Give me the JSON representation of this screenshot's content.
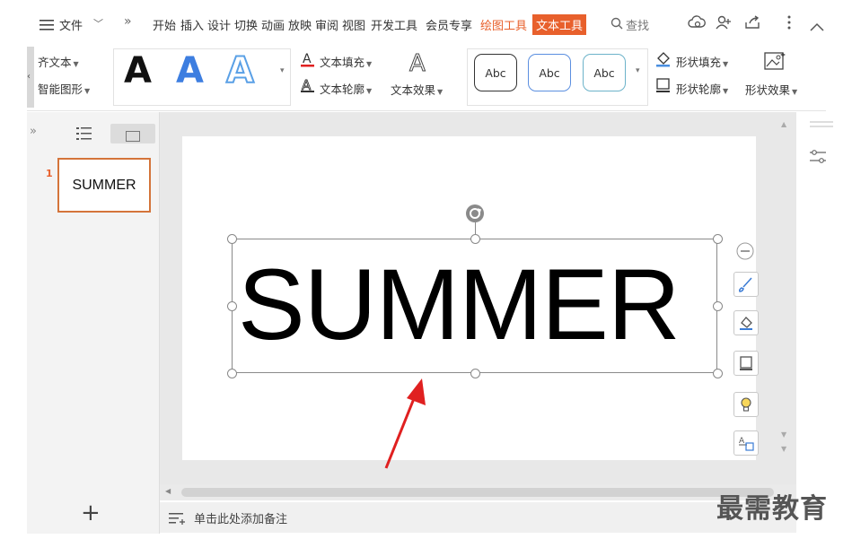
{
  "menubar": {
    "file_label": "文件",
    "tabs": [
      "开始",
      "插入",
      "设计",
      "切换",
      "动画",
      "放映",
      "审阅",
      "视图",
      "开发工具",
      "会员专享"
    ],
    "draw_tools_tab": "绘图工具",
    "text_tools_tab": "文本工具",
    "search_label": "查找"
  },
  "ribbon": {
    "align_text": "齐文本",
    "smart_shape": "智能图形",
    "wordart_styles": [
      "A",
      "A",
      "A"
    ],
    "text_fill": "文本填充",
    "text_outline": "文本轮廓",
    "text_effect": "文本效果",
    "shape_styles": [
      "Abc",
      "Abc",
      "Abc"
    ],
    "shape_fill": "形状填充",
    "shape_outline": "形状轮廓",
    "shape_effect": "形状效果"
  },
  "left_pane": {
    "slide_number": "1",
    "thumbnail_text": "SUMMER",
    "add_slide": "+"
  },
  "slide": {
    "text": "SUMMER"
  },
  "notes": {
    "placeholder": "单击此处添加备注"
  },
  "watermark": "最需教育",
  "colors": {
    "accent": "#e8602c",
    "arrow": "#e02020",
    "selection": "#8a8a8a",
    "wordart_blue": "#3d7ee0"
  }
}
